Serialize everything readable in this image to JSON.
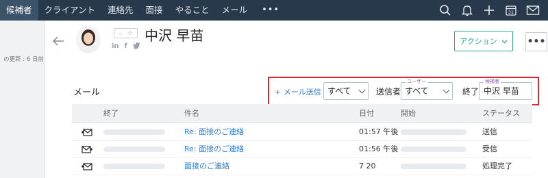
{
  "nav": {
    "tabs": [
      {
        "label": "候補者",
        "active": true
      },
      {
        "label": "クライアント",
        "active": false
      },
      {
        "label": "連絡先",
        "active": false
      },
      {
        "label": "面接",
        "active": false
      },
      {
        "label": "やること",
        "active": false
      },
      {
        "label": "メール",
        "active": false
      }
    ],
    "more": "•••",
    "right_icons": [
      "search-icon",
      "bell-icon",
      "plus-icon",
      "calendar-icon",
      "mail-icon"
    ],
    "calendar_day": "31"
  },
  "sidebar": {
    "last_update": "の更新 : 6 日前"
  },
  "record": {
    "tag_dash": "–",
    "tag_star": "☆",
    "name": "中沢 早苗",
    "social": [
      "in",
      "f",
      "t"
    ],
    "action_label": "アクション",
    "more_label": "•••"
  },
  "mail": {
    "section_title": "メール",
    "send_link": "+ メール送信",
    "filter_all": "すべて",
    "sender_label": "送信者",
    "user_float": "ユーザー",
    "user_value": "すべて",
    "end_label": "終了",
    "candidate_float": "候補者",
    "candidate_value": "中沢 早苗"
  },
  "table": {
    "headers": {
      "end": "終了",
      "subject": "件名",
      "date": "日付",
      "start": "開始",
      "status": "ステータス"
    },
    "rows": [
      {
        "icon": "mail-reply-icon",
        "subject": "Re: 面接のご連絡",
        "date": "01:57 午後",
        "status": "送信"
      },
      {
        "icon": "mail-forward-icon",
        "subject": "Re: 面接のご連絡",
        "date": "01:56 午後",
        "status": "受信"
      },
      {
        "icon": "mail-reply-icon",
        "subject": "面接のご連絡",
        "date": "7 20",
        "status": "処理完了"
      }
    ]
  },
  "colors": {
    "nav_bg": "#27394b",
    "accent_green": "#2eaa8a",
    "link_blue": "#2c7ed0",
    "highlight_red": "#e0262d"
  }
}
